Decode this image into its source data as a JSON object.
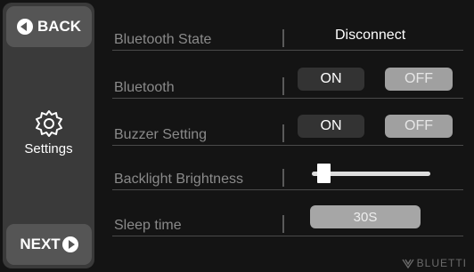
{
  "nav": {
    "back_label": "BACK",
    "next_label": "NEXT",
    "current_page_label": "Settings"
  },
  "rows": {
    "bluetooth_state": {
      "label": "Bluetooth State",
      "value": "Disconnect"
    },
    "bluetooth": {
      "label": "Bluetooth",
      "on_label": "ON",
      "off_label": "OFF"
    },
    "buzzer": {
      "label": "Buzzer Setting",
      "on_label": "ON",
      "off_label": "OFF"
    },
    "backlight": {
      "label": "Backlight Brightness",
      "level": 0.05
    },
    "sleep": {
      "label": "Sleep time",
      "value": "30S"
    }
  },
  "brand": {
    "name": "BLUETTI"
  },
  "icons": {
    "back": "back-arrow-icon",
    "next": "next-arrow-icon",
    "settings": "gear-icon",
    "brand": "bluetti-logo-icon"
  },
  "colors": {
    "background": "#141414",
    "sidebar": "#3a3a3a",
    "nav_button": "#555555",
    "label_text": "#8a8a8a",
    "toggle_active": "#333333",
    "toggle_inactive": "#a0a0a0"
  }
}
